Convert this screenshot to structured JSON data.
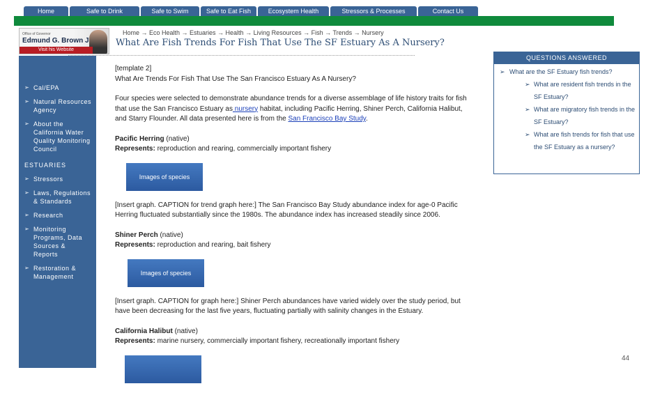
{
  "nav": {
    "tabs": [
      "Home",
      "Safe to Drink",
      "Safe to Swim",
      "Safe to Eat Fish",
      "Ecosystem Health",
      "Stressors & Processes",
      "Contact Us"
    ]
  },
  "governor": {
    "office": "Office of Governor",
    "name": "Edmund G. Brown Jr.",
    "link": "Visit his Website"
  },
  "breadcrumb": "Home → Eco Health → Estuaries → Health → Living Resources → Fish → Trends → Nursery",
  "page_title": "What Are Fish Trends For Fish That Use The SF Estuary As A Nursery?",
  "sidebar": {
    "items": [
      "Cal/EPA",
      "Natural Resources Agency",
      "About the California Water Quality Monitoring Council"
    ],
    "heading": "ESTUARIES",
    "sub_items": [
      "Stressors",
      "Laws, Regulations & Standards",
      "Research",
      "Monitoring Programs, Data Sources & Reports",
      "Restoration & Management"
    ]
  },
  "main": {
    "template": "[template 2]",
    "heading": "What Are Trends For Fish That Use The San Francisco Estuary As A Nursery?",
    "intro_1": "Four species were selected to demonstrate abundance trends for a diverse assemblage of life history traits for fish that use the San Francisco Estuary as",
    "intro_link": " nursery",
    "intro_2": " habitat, including Pacific Herring, Shiner Perch, California Halibut, and Starry Flounder. All data presented here is from the ",
    "intro_link2": "San Francisco Bay Study",
    "intro_3": ".",
    "species": [
      {
        "name": "Pacific Herring",
        "origin": " (native)",
        "rep_label": "Represents:",
        "rep": " reproduction and rearing, commercially important fishery",
        "image": "Images  of species",
        "caption": "[Insert graph.  CAPTION for trend graph here:] The San Francisco Bay Study abundance index for age-0 Pacific Herring fluctuated substantially since the 1980s. The abundance index has increased steadily since 2006."
      },
      {
        "name": "Shiner Perch",
        "origin": " (native)",
        "rep_label": "Represents:",
        "rep": " reproduction and rearing, bait fishery",
        "image": "Images  of species",
        "caption": "[Insert graph. CAPTION for graph here:] Shiner Perch abundances have varied widely over the study period, but have been decreasing for the last five years, fluctuating partially with salinity changes in the Estuary."
      },
      {
        "name": "California Halibut",
        "origin": " (native)",
        "rep_label": "Represents:",
        "rep": " marine nursery, commercially important fishery, recreationally important fishery"
      }
    ]
  },
  "questions": {
    "header": "QUESTIONS ANSWERED",
    "main": "What are the SF Estuary fish trends?",
    "sub": [
      "What are resident fish trends in the SF Estuary?",
      "What are migratory fish trends in the SF Estuary?",
      "What are fish trends for fish that use the SF Estuary as a nursery?"
    ]
  },
  "page_number": "44"
}
